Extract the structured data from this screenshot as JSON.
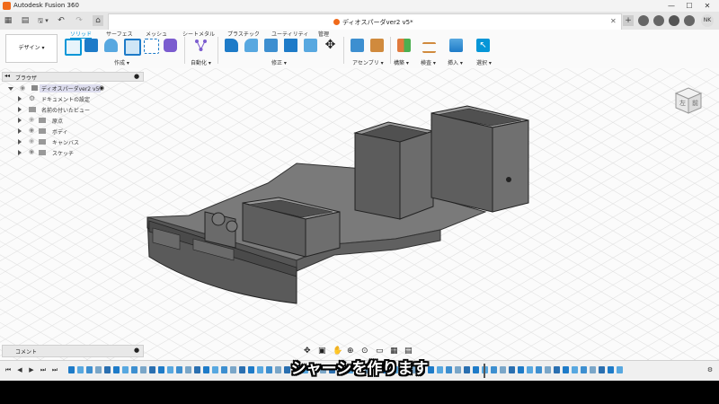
{
  "app": {
    "title": "Autodesk Fusion 360",
    "min": "—",
    "max": "☐",
    "close": "✕"
  },
  "tabs": {
    "document_name": "ディオスパーダver2 v5*",
    "close": "✕",
    "add": "+",
    "avatar": "NK"
  },
  "quick_access": {
    "grid": "▦",
    "file": "▤",
    "undo": "↶",
    "redo": "↷",
    "home": "⌂"
  },
  "ribbon": {
    "workspace": "デザイン ▾",
    "tabs": [
      "ソリッド",
      "サーフェス",
      "メッシュ",
      "シートメタル",
      "プラスチック",
      "ユーティリティ",
      "管理"
    ],
    "groups": [
      "作成 ▾",
      "自動化 ▾",
      "修正 ▾",
      "アセンブリ ▾",
      "構築 ▾",
      "検査 ▾",
      "挿入 ▾",
      "選択 ▾"
    ]
  },
  "browser": {
    "header": "ブラウザ",
    "root": "ディオスパーダver2 v5",
    "items": [
      "ドキュメントの設定",
      "名前の付いたビュー",
      "原点",
      "ボディ",
      "キャンバス",
      "スケッチ"
    ]
  },
  "comments": {
    "label": "コメント"
  },
  "view_cube": {
    "left": "左",
    "front": "前"
  },
  "timeline": {
    "feature_count": 62
  },
  "subtitle": "シャーシを作ります",
  "colors": {
    "accent": "#0696d7",
    "model_dark": "#4a4a4a",
    "model_top": "#8a8a8a",
    "model_face": "#6c6c6c"
  }
}
